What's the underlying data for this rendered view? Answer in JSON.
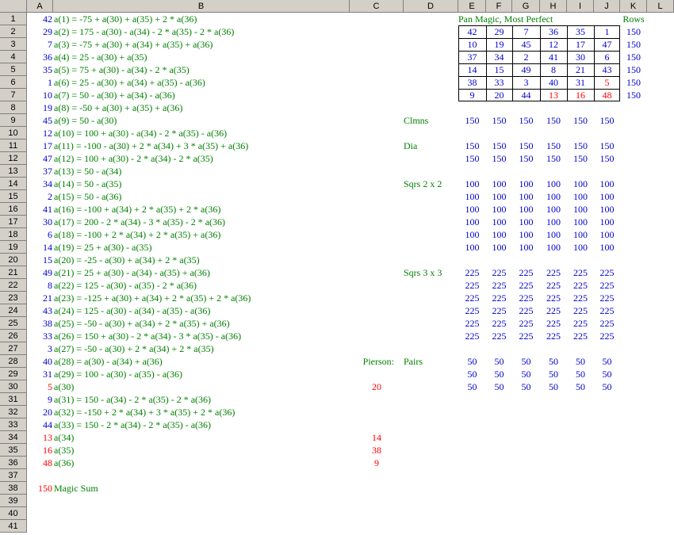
{
  "columns": [
    "A",
    "B",
    "C",
    "D",
    "E",
    "F",
    "G",
    "H",
    "I",
    "J",
    "K",
    "L"
  ],
  "rows": [
    "1",
    "2",
    "3",
    "4",
    "5",
    "6",
    "7",
    "8",
    "9",
    "10",
    "11",
    "12",
    "13",
    "14",
    "15",
    "16",
    "17",
    "18",
    "19",
    "20",
    "21",
    "22",
    "23",
    "24",
    "25",
    "26",
    "27",
    "28",
    "29",
    "30",
    "31",
    "32",
    "33",
    "34",
    "35",
    "36",
    "37",
    "38",
    "39",
    "40",
    "41"
  ],
  "colA": [
    {
      "v": "42",
      "c": "blue"
    },
    {
      "v": "29",
      "c": "blue"
    },
    {
      "v": "7",
      "c": "blue"
    },
    {
      "v": "36",
      "c": "blue"
    },
    {
      "v": "35",
      "c": "blue"
    },
    {
      "v": "1",
      "c": "blue"
    },
    {
      "v": "10",
      "c": "blue"
    },
    {
      "v": "19",
      "c": "blue"
    },
    {
      "v": "45",
      "c": "blue"
    },
    {
      "v": "12",
      "c": "blue"
    },
    {
      "v": "17",
      "c": "blue"
    },
    {
      "v": "47",
      "c": "blue"
    },
    {
      "v": "37",
      "c": "blue"
    },
    {
      "v": "34",
      "c": "blue"
    },
    {
      "v": "2",
      "c": "blue"
    },
    {
      "v": "41",
      "c": "blue"
    },
    {
      "v": "30",
      "c": "blue"
    },
    {
      "v": "6",
      "c": "blue"
    },
    {
      "v": "14",
      "c": "blue"
    },
    {
      "v": "15",
      "c": "blue"
    },
    {
      "v": "49",
      "c": "blue"
    },
    {
      "v": "8",
      "c": "blue"
    },
    {
      "v": "21",
      "c": "blue"
    },
    {
      "v": "43",
      "c": "blue"
    },
    {
      "v": "38",
      "c": "blue"
    },
    {
      "v": "33",
      "c": "blue"
    },
    {
      "v": "3",
      "c": "blue"
    },
    {
      "v": "40",
      "c": "blue"
    },
    {
      "v": "31",
      "c": "blue"
    },
    {
      "v": "5",
      "c": "red"
    },
    {
      "v": "9",
      "c": "blue"
    },
    {
      "v": "20",
      "c": "blue"
    },
    {
      "v": "44",
      "c": "blue"
    },
    {
      "v": "13",
      "c": "red"
    },
    {
      "v": "16",
      "c": "red"
    },
    {
      "v": "48",
      "c": "red"
    },
    {
      "v": "",
      "c": "blue"
    },
    {
      "v": "150",
      "c": "red"
    },
    {
      "v": "",
      "c": "blue"
    },
    {
      "v": "",
      "c": "blue"
    },
    {
      "v": "",
      "c": "blue"
    }
  ],
  "colB": [
    "a(1) = -75 + a(30) + a(35) + 2 * a(36)",
    "a(2) = 175 - a(30) - a(34) - 2 * a(35) - 2 * a(36)",
    "a(3) = -75 + a(30) + a(34) + a(35) + a(36)",
    "a(4) = 25 - a(30) + a(35)",
    "a(5) = 75 + a(30) - a(34) - 2 * a(35)",
    "a(6) = 25 - a(30) + a(34) + a(35) - a(36)",
    "a(7) = 50 - a(30) + a(34) - a(36)",
    "a(8) = -50 + a(30) + a(35) + a(36)",
    "a(9) = 50 - a(30)",
    "a(10) = 100 + a(30) - a(34) - 2 * a(35) - a(36)",
    "a(11) = -100 - a(30) + 2 * a(34) + 3 * a(35) + a(36)",
    "a(12) = 100 + a(30) - 2 * a(34) - 2 * a(35)",
    "a(13) = 50 - a(34)",
    "a(14) = 50 - a(35)",
    "a(15) = 50 - a(36)",
    "a(16) = -100 + a(34) + 2 * a(35) + 2 * a(36)",
    "a(17) = 200 - 2 * a(34) - 3 * a(35) - 2 * a(36)",
    "a(18) = -100 + 2 * a(34) + 2 * a(35) + a(36)",
    "a(19) = 25 + a(30) - a(35)",
    "a(20) = -25 - a(30) + a(34) + 2 * a(35)",
    "a(21) = 25 + a(30) - a(34) - a(35) + a(36)",
    "a(22) = 125 - a(30) - a(35) - 2 * a(36)",
    "a(23) = -125 + a(30) + a(34) + 2 * a(35) + 2 * a(36)",
    "a(24) = 125 - a(30) - a(34) - a(35) - a(36)",
    "a(25) = -50 - a(30) + a(34) + 2 * a(35) + a(36)",
    "a(26) = 150 + a(30) - 2 * a(34) - 3 * a(35) - a(36)",
    "a(27) = -50 - a(30) + 2 * a(34) + 2 * a(35)",
    "a(28) = a(30) - a(34) + a(36)",
    "a(29) = 100 - a(30) - a(35) - a(36)",
    "a(30)",
    "a(31) = 150 - a(34) - 2 * a(35) - 2 * a(36)",
    "a(32) = -150 + 2 * a(34) + 3 * a(35) + 2 * a(36)",
    "a(33) = 150 - 2 * a(34) - 2 * a(35) - a(36)",
    "a(34)",
    "a(35)",
    "a(36)",
    "",
    "Magic Sum",
    "",
    "",
    ""
  ],
  "title": "Pan Magic, Most Perfect",
  "rows_label": "Rows",
  "square": [
    [
      {
        "v": "42",
        "c": "blue"
      },
      {
        "v": "29",
        "c": "blue"
      },
      {
        "v": "7",
        "c": "blue"
      },
      {
        "v": "36",
        "c": "blue"
      },
      {
        "v": "35",
        "c": "blue"
      },
      {
        "v": "1",
        "c": "blue"
      }
    ],
    [
      {
        "v": "10",
        "c": "blue"
      },
      {
        "v": "19",
        "c": "blue"
      },
      {
        "v": "45",
        "c": "blue"
      },
      {
        "v": "12",
        "c": "blue"
      },
      {
        "v": "17",
        "c": "blue"
      },
      {
        "v": "47",
        "c": "blue"
      }
    ],
    [
      {
        "v": "37",
        "c": "blue"
      },
      {
        "v": "34",
        "c": "blue"
      },
      {
        "v": "2",
        "c": "blue"
      },
      {
        "v": "41",
        "c": "blue"
      },
      {
        "v": "30",
        "c": "blue"
      },
      {
        "v": "6",
        "c": "blue"
      }
    ],
    [
      {
        "v": "14",
        "c": "blue"
      },
      {
        "v": "15",
        "c": "blue"
      },
      {
        "v": "49",
        "c": "blue"
      },
      {
        "v": "8",
        "c": "blue"
      },
      {
        "v": "21",
        "c": "blue"
      },
      {
        "v": "43",
        "c": "blue"
      }
    ],
    [
      {
        "v": "38",
        "c": "blue"
      },
      {
        "v": "33",
        "c": "blue"
      },
      {
        "v": "3",
        "c": "blue"
      },
      {
        "v": "40",
        "c": "blue"
      },
      {
        "v": "31",
        "c": "blue"
      },
      {
        "v": "5",
        "c": "red"
      }
    ],
    [
      {
        "v": "9",
        "c": "blue"
      },
      {
        "v": "20",
        "c": "blue"
      },
      {
        "v": "44",
        "c": "blue"
      },
      {
        "v": "13",
        "c": "red"
      },
      {
        "v": "16",
        "c": "red"
      },
      {
        "v": "48",
        "c": "red"
      }
    ]
  ],
  "row_sums": [
    "150",
    "150",
    "150",
    "150",
    "150",
    "150"
  ],
  "checks": {
    "columns_label": "Clmns",
    "columns": [
      "150",
      "150",
      "150",
      "150",
      "150",
      "150"
    ],
    "dia_label": "Dia",
    "dia": [
      [
        "150",
        "150",
        "150",
        "150",
        "150",
        "150"
      ],
      [
        "150",
        "150",
        "150",
        "150",
        "150",
        "150"
      ]
    ],
    "sq2_label": "Sqrs 2 x 2",
    "sq2": [
      [
        "100",
        "100",
        "100",
        "100",
        "100",
        "100"
      ],
      [
        "100",
        "100",
        "100",
        "100",
        "100",
        "100"
      ],
      [
        "100",
        "100",
        "100",
        "100",
        "100",
        "100"
      ],
      [
        "100",
        "100",
        "100",
        "100",
        "100",
        "100"
      ],
      [
        "100",
        "100",
        "100",
        "100",
        "100",
        "100"
      ],
      [
        "100",
        "100",
        "100",
        "100",
        "100",
        "100"
      ]
    ],
    "sq3_label": "Sqrs 3 x 3",
    "sq3": [
      [
        "225",
        "225",
        "225",
        "225",
        "225",
        "225"
      ],
      [
        "225",
        "225",
        "225",
        "225",
        "225",
        "225"
      ],
      [
        "225",
        "225",
        "225",
        "225",
        "225",
        "225"
      ],
      [
        "225",
        "225",
        "225",
        "225",
        "225",
        "225"
      ],
      [
        "225",
        "225",
        "225",
        "225",
        "225",
        "225"
      ],
      [
        "225",
        "225",
        "225",
        "225",
        "225",
        "225"
      ]
    ],
    "pairs_label": "Pairs",
    "pairs": [
      [
        "50",
        "50",
        "50",
        "50",
        "50",
        "50"
      ],
      [
        "50",
        "50",
        "50",
        "50",
        "50",
        "50"
      ],
      [
        "50",
        "50",
        "50",
        "50",
        "50",
        "50"
      ]
    ]
  },
  "pierson": {
    "label": "Pierson:",
    "values": [
      "20",
      "14",
      "38",
      "9"
    ]
  },
  "colors": {
    "formula": "#008000",
    "number": "#0000cc",
    "highlight": "#ff0000",
    "header_bg": "#d4d0c8"
  }
}
